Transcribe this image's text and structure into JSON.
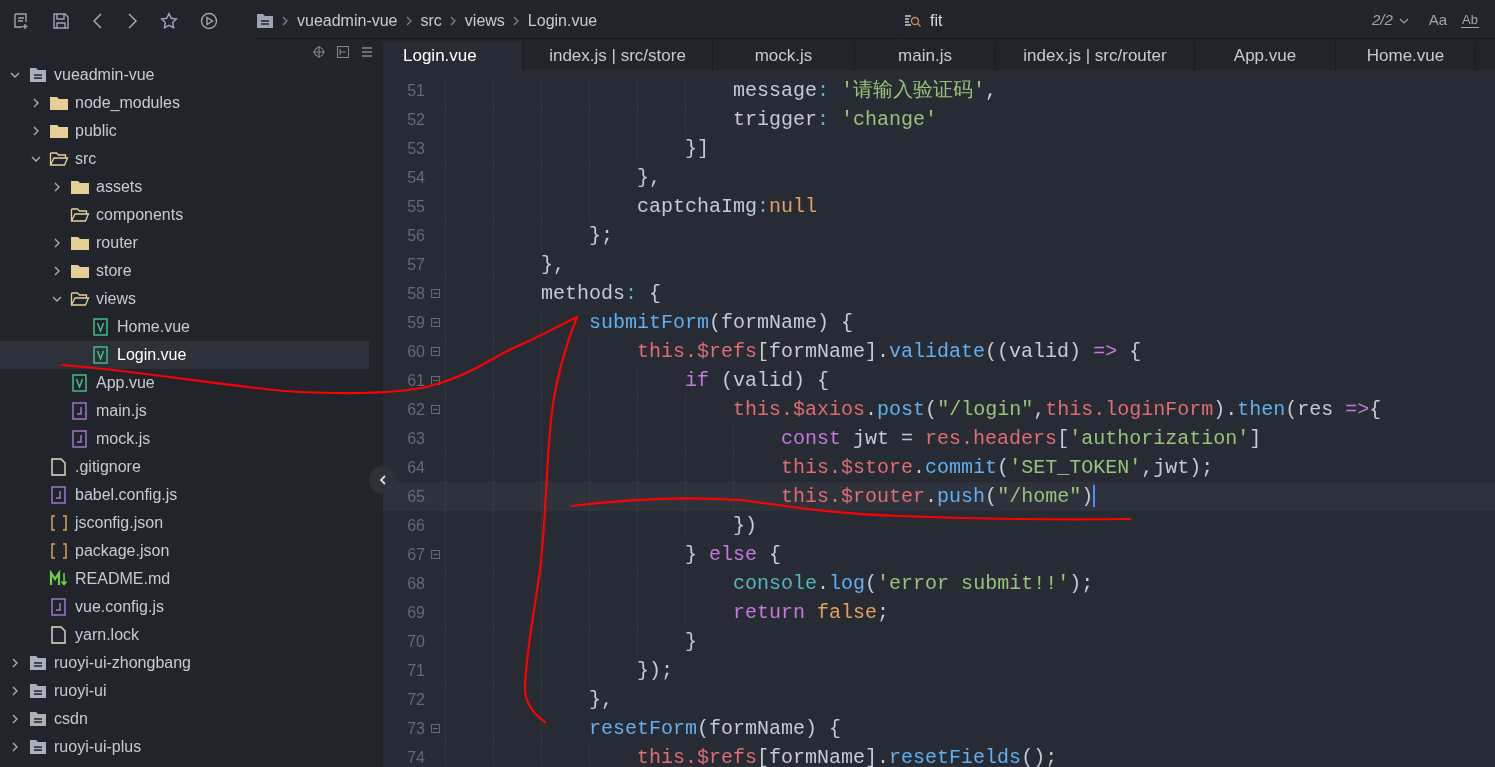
{
  "toolbar": {
    "breadcrumb": [
      "vueadmin-vue",
      "src",
      "views",
      "Login.vue"
    ],
    "search": {
      "value": "fit",
      "match_count": "2/2",
      "match_case": "Aa",
      "whole_word": "Ab"
    }
  },
  "sidebar": {
    "items": [
      {
        "label": "vueadmin-vue",
        "kind": "project",
        "expanded": true,
        "selected": false,
        "children": [
          {
            "label": "node_modules",
            "kind": "folder",
            "expanded": false,
            "selected": false
          },
          {
            "label": "public",
            "kind": "folder",
            "expanded": false,
            "selected": false
          },
          {
            "label": "src",
            "kind": "folder",
            "expanded": true,
            "selected": false,
            "children": [
              {
                "label": "assets",
                "kind": "folder",
                "expanded": false,
                "selected": false
              },
              {
                "label": "components",
                "kind": "empty-folder",
                "expanded": false,
                "selected": false
              },
              {
                "label": "router",
                "kind": "folder",
                "expanded": false,
                "selected": false
              },
              {
                "label": "store",
                "kind": "folder",
                "expanded": false,
                "selected": false
              },
              {
                "label": "views",
                "kind": "folder",
                "expanded": true,
                "selected": false,
                "children": [
                  {
                    "label": "Home.vue",
                    "kind": "vue",
                    "selected": false
                  },
                  {
                    "label": "Login.vue",
                    "kind": "vue",
                    "selected": true
                  }
                ]
              },
              {
                "label": "App.vue",
                "kind": "vue",
                "selected": false
              },
              {
                "label": "main.js",
                "kind": "js",
                "selected": false
              },
              {
                "label": "mock.js",
                "kind": "js",
                "selected": false
              }
            ]
          },
          {
            "label": ".gitignore",
            "kind": "file",
            "selected": false
          },
          {
            "label": "babel.config.js",
            "kind": "js",
            "selected": false
          },
          {
            "label": "jsconfig.json",
            "kind": "json",
            "selected": false
          },
          {
            "label": "package.json",
            "kind": "json",
            "selected": false
          },
          {
            "label": "README.md",
            "kind": "md",
            "selected": false
          },
          {
            "label": "vue.config.js",
            "kind": "js",
            "selected": false
          },
          {
            "label": "yarn.lock",
            "kind": "file",
            "selected": false
          }
        ]
      },
      {
        "label": "ruoyi-ui-zhongbang",
        "kind": "project",
        "expanded": false,
        "selected": false
      },
      {
        "label": "ruoyi-ui",
        "kind": "project",
        "expanded": false,
        "selected": false
      },
      {
        "label": "csdn",
        "kind": "project",
        "expanded": false,
        "selected": false
      },
      {
        "label": "ruoyi-ui-plus",
        "kind": "project",
        "expanded": false,
        "selected": false
      }
    ]
  },
  "tabs": [
    {
      "label": "Login.vue",
      "selected": true
    },
    {
      "label": "index.js | src/store",
      "selected": false
    },
    {
      "label": "mock.js",
      "selected": false
    },
    {
      "label": "main.js",
      "selected": false
    },
    {
      "label": "index.js | src/router",
      "selected": false
    },
    {
      "label": "App.vue",
      "selected": false
    },
    {
      "label": "Home.vue",
      "selected": false
    }
  ],
  "editor": {
    "lines": [
      {
        "number": "51",
        "foldable": false,
        "current": false,
        "tokens": [
          {
            "kind": "plain",
            "text": "                        message"
          },
          {
            "kind": "punct",
            "text": ": "
          },
          {
            "kind": "string",
            "text": "'请输入验证码'"
          },
          {
            "kind": "plain",
            "text": ","
          }
        ]
      },
      {
        "number": "52",
        "foldable": false,
        "current": false,
        "tokens": [
          {
            "kind": "plain",
            "text": "                        trigger"
          },
          {
            "kind": "punct",
            "text": ": "
          },
          {
            "kind": "string",
            "text": "'change'"
          }
        ]
      },
      {
        "number": "53",
        "foldable": false,
        "current": false,
        "tokens": [
          {
            "kind": "plain",
            "text": "                    }]"
          }
        ]
      },
      {
        "number": "54",
        "foldable": false,
        "current": false,
        "tokens": [
          {
            "kind": "plain",
            "text": "                },"
          }
        ]
      },
      {
        "number": "55",
        "foldable": false,
        "current": false,
        "tokens": [
          {
            "kind": "plain",
            "text": "                captchaImg"
          },
          {
            "kind": "punct",
            "text": ":"
          },
          {
            "kind": "literal",
            "text": "null"
          }
        ]
      },
      {
        "number": "56",
        "foldable": false,
        "current": false,
        "tokens": [
          {
            "kind": "plain",
            "text": "            };"
          }
        ]
      },
      {
        "number": "57",
        "foldable": false,
        "current": false,
        "tokens": [
          {
            "kind": "plain",
            "text": "        },"
          }
        ]
      },
      {
        "number": "58",
        "foldable": true,
        "current": false,
        "tokens": [
          {
            "kind": "plain",
            "text": "        methods"
          },
          {
            "kind": "punct",
            "text": ": "
          },
          {
            "kind": "plain",
            "text": "{"
          }
        ]
      },
      {
        "number": "59",
        "foldable": true,
        "current": false,
        "tokens": [
          {
            "kind": "func",
            "text": "            submitForm"
          },
          {
            "kind": "plain",
            "text": "(formName) {"
          }
        ]
      },
      {
        "number": "60",
        "foldable": true,
        "current": false,
        "tokens": [
          {
            "kind": "this",
            "text": "                this.$refs"
          },
          {
            "kind": "plain",
            "text": "[formName]."
          },
          {
            "kind": "func",
            "text": "validate"
          },
          {
            "kind": "plain",
            "text": "((valid) "
          },
          {
            "kind": "keyword",
            "text": "=>"
          },
          {
            "kind": "plain",
            "text": " {"
          }
        ]
      },
      {
        "number": "61",
        "foldable": true,
        "current": false,
        "tokens": [
          {
            "kind": "keyword",
            "text": "                    if"
          },
          {
            "kind": "plain",
            "text": " (valid) {"
          }
        ]
      },
      {
        "number": "62",
        "foldable": true,
        "current": false,
        "tokens": [
          {
            "kind": "this",
            "text": "                        this.$axios"
          },
          {
            "kind": "plain",
            "text": "."
          },
          {
            "kind": "func",
            "text": "post"
          },
          {
            "kind": "plain",
            "text": "("
          },
          {
            "kind": "string",
            "text": "\"/login\""
          },
          {
            "kind": "plain",
            "text": ","
          },
          {
            "kind": "this",
            "text": "this.loginForm"
          },
          {
            "kind": "plain",
            "text": ")."
          },
          {
            "kind": "func",
            "text": "then"
          },
          {
            "kind": "plain",
            "text": "(res "
          },
          {
            "kind": "keyword",
            "text": "=>"
          },
          {
            "kind": "plain",
            "text": "{"
          }
        ]
      },
      {
        "number": "63",
        "foldable": false,
        "current": false,
        "tokens": [
          {
            "kind": "keyword",
            "text": "                            const"
          },
          {
            "kind": "plain",
            "text": " jwt = "
          },
          {
            "kind": "this",
            "text": "res.headers"
          },
          {
            "kind": "plain",
            "text": "["
          },
          {
            "kind": "string",
            "text": "'authorization'"
          },
          {
            "kind": "plain",
            "text": "]"
          }
        ]
      },
      {
        "number": "64",
        "foldable": false,
        "current": false,
        "tokens": [
          {
            "kind": "this",
            "text": "                            this.$store"
          },
          {
            "kind": "plain",
            "text": "."
          },
          {
            "kind": "func",
            "text": "commit"
          },
          {
            "kind": "plain",
            "text": "("
          },
          {
            "kind": "string",
            "text": "'SET_TOKEN'"
          },
          {
            "kind": "plain",
            "text": ",jwt);"
          }
        ]
      },
      {
        "number": "65",
        "foldable": false,
        "current": true,
        "tokens": [
          {
            "kind": "this",
            "text": "                            this.$router"
          },
          {
            "kind": "plain",
            "text": "."
          },
          {
            "kind": "func",
            "text": "push"
          },
          {
            "kind": "plain",
            "text": "("
          },
          {
            "kind": "string",
            "text": "\"/home\""
          },
          {
            "kind": "plain",
            "text": ")"
          }
        ]
      },
      {
        "number": "66",
        "foldable": false,
        "current": false,
        "tokens": [
          {
            "kind": "plain",
            "text": "                        })"
          }
        ]
      },
      {
        "number": "67",
        "foldable": true,
        "current": false,
        "tokens": [
          {
            "kind": "plain",
            "text": "                    } "
          },
          {
            "kind": "keyword",
            "text": "else"
          },
          {
            "kind": "plain",
            "text": " {"
          }
        ]
      },
      {
        "number": "68",
        "foldable": false,
        "current": false,
        "tokens": [
          {
            "kind": "builtin",
            "text": "                        console"
          },
          {
            "kind": "plain",
            "text": "."
          },
          {
            "kind": "func",
            "text": "log"
          },
          {
            "kind": "plain",
            "text": "("
          },
          {
            "kind": "string",
            "text": "'error submit!!'"
          },
          {
            "kind": "plain",
            "text": ");"
          }
        ]
      },
      {
        "number": "69",
        "foldable": false,
        "current": false,
        "tokens": [
          {
            "kind": "keyword",
            "text": "                        return"
          },
          {
            "kind": "literal",
            "text": " false"
          },
          {
            "kind": "plain",
            "text": ";"
          }
        ]
      },
      {
        "number": "70",
        "foldable": false,
        "current": false,
        "tokens": [
          {
            "kind": "plain",
            "text": "                    }"
          }
        ]
      },
      {
        "number": "71",
        "foldable": false,
        "current": false,
        "tokens": [
          {
            "kind": "plain",
            "text": "                });"
          }
        ]
      },
      {
        "number": "72",
        "foldable": false,
        "current": false,
        "tokens": [
          {
            "kind": "plain",
            "text": "            },"
          }
        ]
      },
      {
        "number": "73",
        "foldable": true,
        "current": false,
        "tokens": [
          {
            "kind": "func",
            "text": "            resetForm"
          },
          {
            "kind": "plain",
            "text": "(formName) {"
          }
        ]
      },
      {
        "number": "74",
        "foldable": false,
        "current": false,
        "tokens": [
          {
            "kind": "this",
            "text": "                this.$refs"
          },
          {
            "kind": "plain",
            "text": "[formName]."
          },
          {
            "kind": "func",
            "text": "resetFields"
          },
          {
            "kind": "plain",
            "text": "();"
          }
        ]
      }
    ]
  }
}
